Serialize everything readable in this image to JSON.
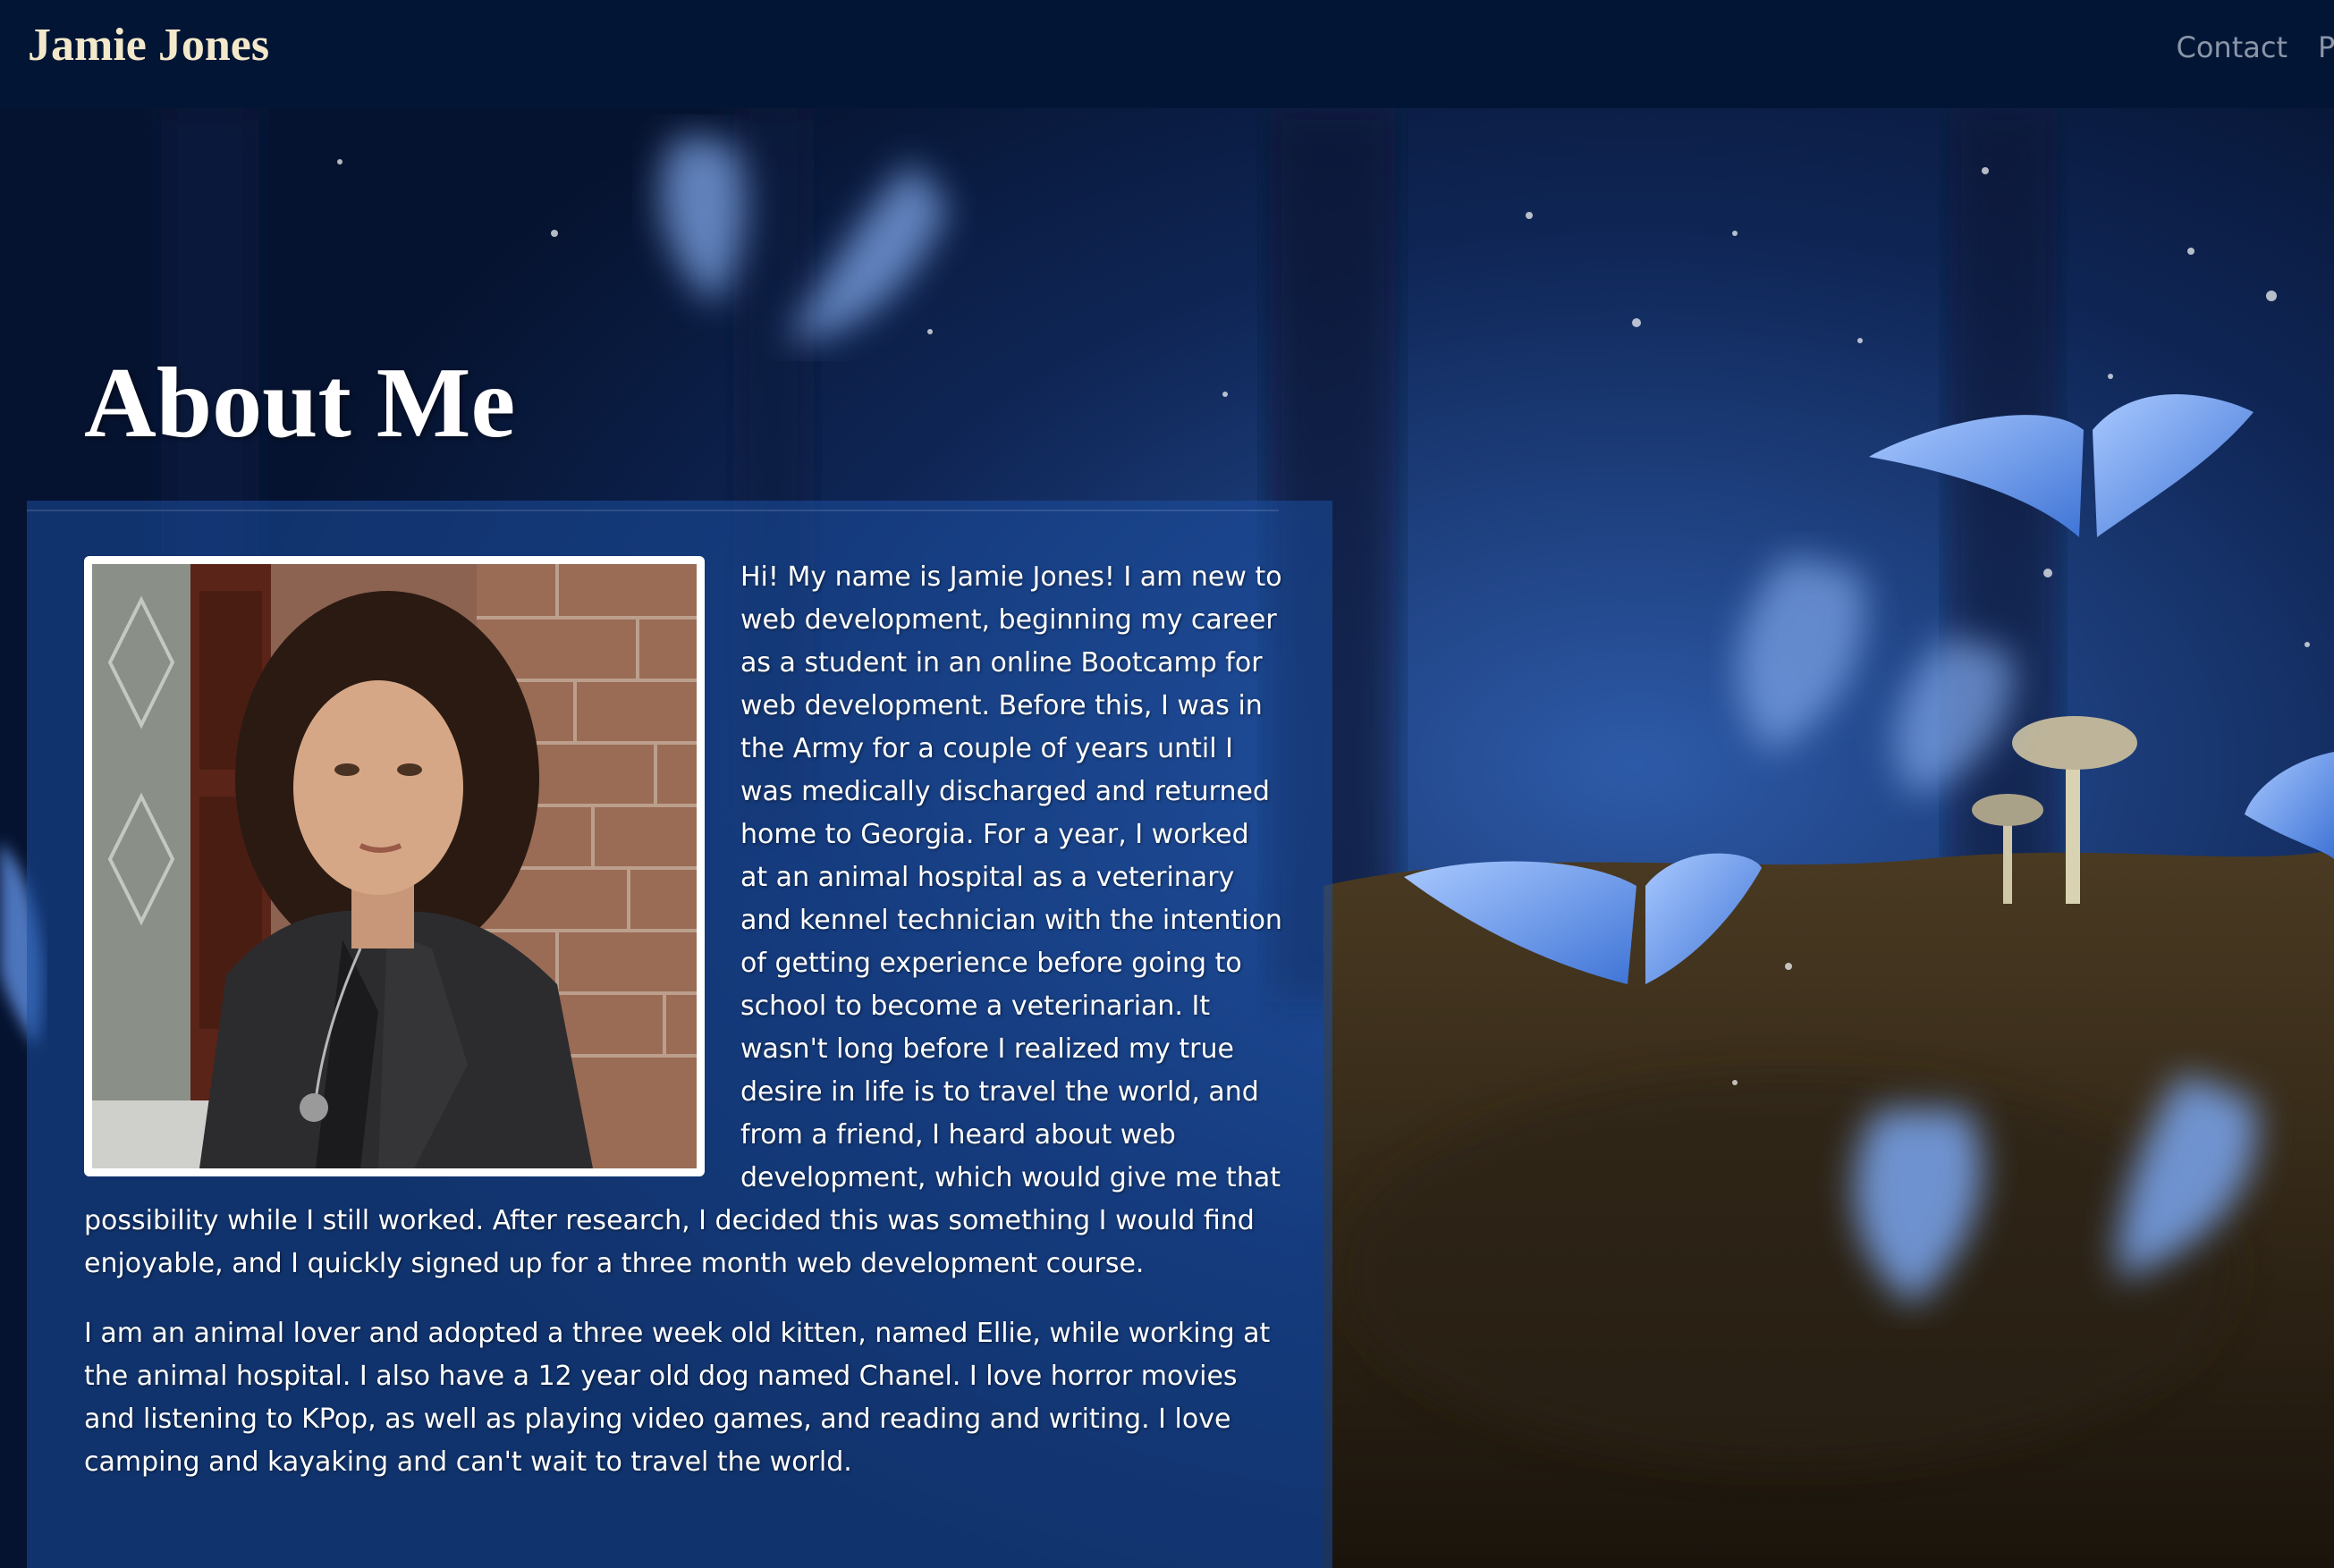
{
  "navbar": {
    "brand": "Jamie Jones",
    "links": [
      "Contact",
      "P"
    ]
  },
  "about": {
    "title": "About Me",
    "photo_alt": "Portrait of Jamie Jones",
    "paragraphs": [
      "Hi! My name is Jamie Jones! I am new to web development, beginning my career as a student in an online Bootcamp for web development. Before this, I was in the Army for a couple of years until I was medically discharged and returned home to Georgia. For a year, I worked at an animal hospital as a veterinary and kennel technician with the intention of getting experience before going to school to become a veterinarian. It wasn't long before I realized my true desire in life is to travel the world, and from a friend, I heard about web development, which would give me that possibility while I still worked. After research, I decided this was something I would find enjoyable, and I quickly signed up for a three month web development course.",
      "I am an animal lover and adopted a three week old kitten, named Ellie, while working at the animal hospital. I also have a 12 year old dog named Chanel. I love horror movies and listening to KPop, as well as playing video games, and reading and writing. I love camping and kayaking and can't wait to travel the world."
    ]
  },
  "colors": {
    "navbar_bg": "#021535",
    "brand": "#f3e8c9",
    "nav_link": "#8a95a8",
    "panel": "#1c4ea0"
  }
}
